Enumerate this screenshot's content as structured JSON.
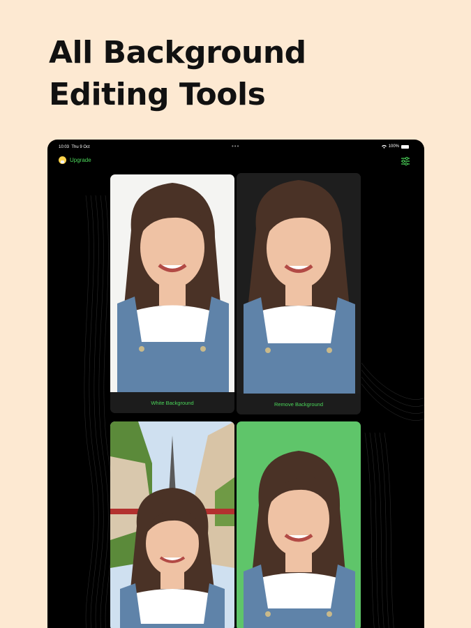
{
  "headline": {
    "line1": "All Background",
    "line2": "Editing Tools"
  },
  "status_bar": {
    "time": "10:03",
    "date": "Thu 9 Oct",
    "battery": "100%"
  },
  "toolbar": {
    "upgrade_label": "Upgrade"
  },
  "cards": [
    {
      "caption": "White Background",
      "style": "white"
    },
    {
      "caption": "Remove Background",
      "style": "removed"
    },
    {
      "caption": "",
      "style": "paris-street"
    },
    {
      "caption": "",
      "style": "green"
    }
  ],
  "colors": {
    "page_background": "#fde9d2",
    "accent_green": "#4bd65a",
    "tablet": "#000000",
    "card": "#1c1c1c"
  }
}
